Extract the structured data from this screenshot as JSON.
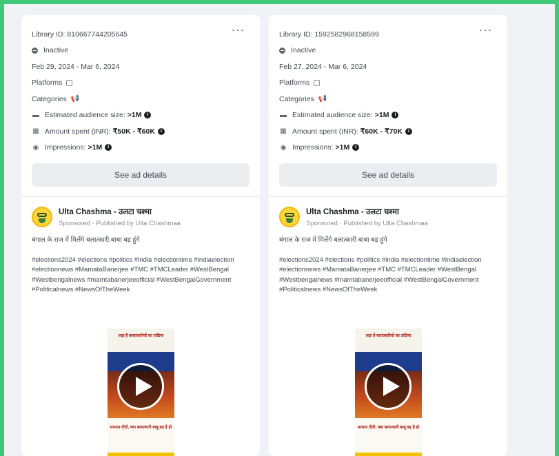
{
  "ads": [
    {
      "library_id": "Library ID: 810667744205645",
      "status": "Inactive",
      "dates": "Feb 29, 2024 - Mar 6, 2024",
      "platforms_label": "Platforms",
      "categories_label": "Categories",
      "audience_label": "Estimated audience size:",
      "audience_value": ">1M",
      "amount_label": "Amount spent (INR):",
      "amount_value": "₹50K - ₹60K",
      "impressions_label": "Impressions:",
      "impressions_value": ">1M",
      "details_button": "See ad details",
      "page_name": "Ulta Chashma - उलटा चश्मा",
      "sponsored": "Sponsored · Published by Ulta Chashmaa",
      "caption": "बंगाल के राज में मिलेंगे बलात्कारी बाबा बड़ हुंगे",
      "hashtags": "#elections2024 #elections #politics #india #electiontime #indiaelection #electionnews #MamataBanerjee #TMC #TMCLeader #WestBengal #Westbengalnews #mamtabanerjeeofficial #WestBengalGovernment #Politicalnews #NewsOfTheWeek",
      "video_top_text": "लड़ा है बलात्कारियों का तांडिया",
      "video_bottom_text": "मरमता दीदी, क्या बलात्कारी बाबू बड़ है हो"
    },
    {
      "library_id": "Library ID: 1592582968158599",
      "status": "Inactive",
      "dates": "Feb 27, 2024 - Mar 6, 2024",
      "platforms_label": "Platforms",
      "categories_label": "Categories",
      "audience_label": "Estimated audience size:",
      "audience_value": ">1M",
      "amount_label": "Amount spent (INR):",
      "amount_value": "₹60K - ₹70K",
      "impressions_label": "Impressions:",
      "impressions_value": ">1M",
      "details_button": "See ad details",
      "page_name": "Ulta Chashma - उलटा चश्मा",
      "sponsored": "Sponsored · Published by Ulta Chashmaa",
      "caption": "बंगाल के राज में मिलेंगे बलात्कारी बाबा बड़ हुंगे",
      "hashtags": "#elections2024 #elections #politics #india #electiontime #indiaelection #electionnews #MamataBanerjee #TMC #TMCLeader #WestBengal #Westbengalnews #mamtabanerjeeofficial #WestBengalGovernment #Politicalnews #NewsOfTheWeek",
      "video_top_text": "लड़ा है बलात्कारियों का तांडिया",
      "video_bottom_text": "मरमता दीदी, क्या बलात्कारी बाबू बड़ है हो"
    }
  ],
  "icons": {
    "more": "more-horizontal-icon",
    "status": "inactive-status-icon",
    "platforms": "platform-icon",
    "categories": "megaphone-icon",
    "audience": "audience-icon",
    "amount": "money-icon",
    "impressions": "eye-icon",
    "info": "info-icon",
    "play": "play-icon"
  },
  "colors": {
    "frame_border": "#3ec97a",
    "page_background": "#f0f2f5",
    "card_background": "#ffffff",
    "button_background": "#ebedf0"
  }
}
